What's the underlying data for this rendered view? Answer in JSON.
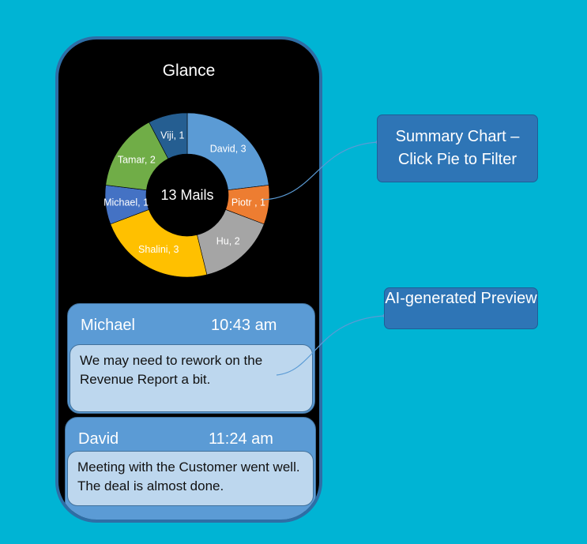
{
  "app": {
    "title": "Glance"
  },
  "chart_data": {
    "type": "pie",
    "variant": "donut",
    "center_label": "13 Mails",
    "slices": [
      {
        "label": "David, 3",
        "name": "David",
        "value": 3,
        "color": "#5B9BD5"
      },
      {
        "label": "Piotr , 1",
        "name": "Piotr",
        "value": 1,
        "color": "#ED7D31"
      },
      {
        "label": "Hu, 2",
        "name": "Hu",
        "value": 2,
        "color": "#A5A5A5"
      },
      {
        "label": "Shalini, 3",
        "name": "Shalini",
        "value": 3,
        "color": "#FFC000"
      },
      {
        "label": "Michael, 1",
        "name": "Michael",
        "value": 1,
        "color": "#4472C4"
      },
      {
        "label": "Tamar, 2",
        "name": "Tamar",
        "value": 2,
        "color": "#70AD47"
      },
      {
        "label": "Viji, 1",
        "name": "Viji",
        "value": 1,
        "color": "#255E91"
      }
    ]
  },
  "mails": [
    {
      "sender": "Michael",
      "time": "10:43 am",
      "preview": "We may need to rework on the Revenue Report a bit."
    },
    {
      "sender": "David",
      "time": "11:24 am",
      "preview": "Meeting with the Customer went well. The deal is almost done."
    }
  ],
  "callouts": {
    "summary": "Summary Chart – Click Pie to Filter",
    "preview": "AI-generated Preview"
  }
}
